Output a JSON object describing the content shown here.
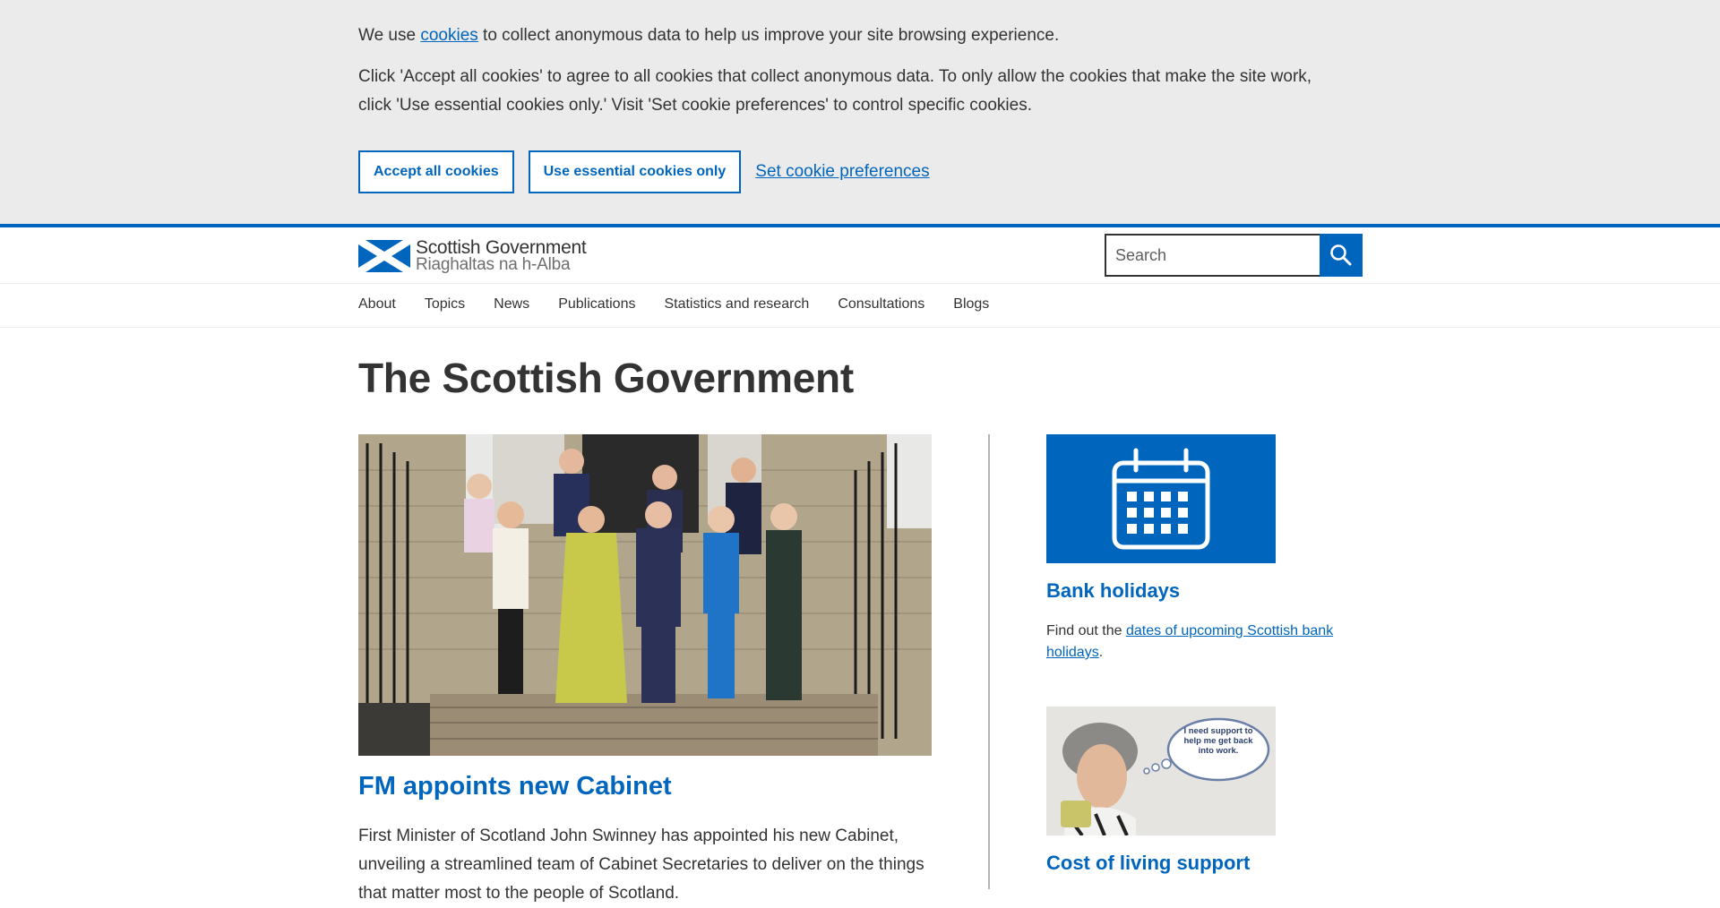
{
  "cookie_banner": {
    "text_before_link": "We use ",
    "cookies_link": "cookies",
    "text_after_link": " to collect anonymous data to help us improve your site browsing experience.",
    "instructions": "Click 'Accept all cookies' to agree to all cookies that collect anonymous data. To only allow the cookies that make the site work, click 'Use essential cookies only.' Visit 'Set cookie preferences' to control specific cookies.",
    "accept_all_label": "Accept all cookies",
    "essential_only_label": "Use essential cookies only",
    "preferences_label": "Set cookie preferences"
  },
  "header": {
    "logo_line1": "Scottish Government",
    "logo_line2": "Riaghaltas na h-Alba",
    "search_placeholder": "Search",
    "brand_color": "#0065bd"
  },
  "nav": {
    "items": [
      "About",
      "Topics",
      "News",
      "Publications",
      "Statistics and research",
      "Consultations",
      "Blogs"
    ]
  },
  "main": {
    "title": "The Scottish Government",
    "feature": {
      "heading": "FM appoints new Cabinet",
      "text": "First Minister of Scotland John Swinney has appointed his new Cabinet, unveiling a streamlined team of Cabinet Secretaries to deliver on the things that matter most to the people of Scotland."
    },
    "bank_holidays": {
      "icon": "calendar-icon",
      "heading": "Bank holidays",
      "text_before_link": "Find out the ",
      "link": "dates of upcoming Scottish bank holidays",
      "text_after_link": "."
    },
    "cost_of_living": {
      "image_thought_bubble": "I need support to help me get back into work.",
      "heading": "Cost of living support"
    }
  }
}
